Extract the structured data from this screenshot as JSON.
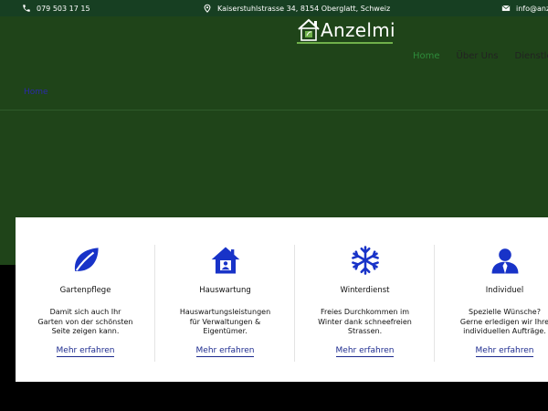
{
  "topbar": {
    "phone": "079 503 17 15",
    "address": "Kaiserstuhlstrasse 34, 8154 Oberglatt, Schweiz",
    "email": "info@anz"
  },
  "logo": {
    "text": "Anzelmi"
  },
  "nav": {
    "items": [
      {
        "label": "Home",
        "active": true
      },
      {
        "label": "Über Uns",
        "active": false
      },
      {
        "label": "Dienstle",
        "active": false
      }
    ]
  },
  "breadcrumb": "Home",
  "colors": {
    "topbar": "#173f22",
    "hero": "#1f4419",
    "accent": "#2e8b3a",
    "icon_blue": "#1833c8",
    "link": "#1d2b8f"
  },
  "services": [
    {
      "icon": "leaf-icon",
      "title": "Gartenpflege",
      "desc": "Damit sich auch Ihr Garten von der schönsten Seite zeigen kann.",
      "link": "Mehr erfahren"
    },
    {
      "icon": "house-icon",
      "title": "Hauswartung",
      "desc": "Hauswartungsleistungen für Verwaltungen & Eigentümer.",
      "link": "Mehr erfahren"
    },
    {
      "icon": "snowflake-icon",
      "title": "Winterdienst",
      "desc": "Freies Durchkommen im Winter dank schneefreien Strassen.",
      "link": "Mehr erfahren"
    },
    {
      "icon": "user-icon",
      "title": "Individuel",
      "desc": "Spezielle Wünsche? Gerne erledigen wir Ihre individuellen Aufträge.",
      "link": "Mehr erfahren"
    }
  ]
}
